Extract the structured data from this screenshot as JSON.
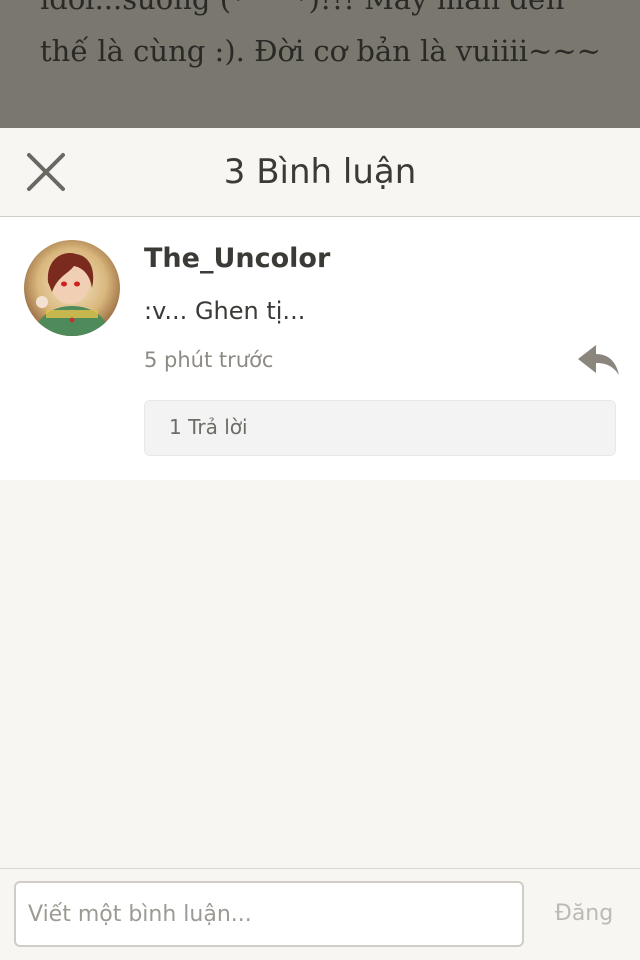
{
  "backdrop": {
    "line1": "idol...sướng (*^^*)!!! May mắn đến",
    "line2": "thế là cùng :). Đời cơ bản là vuiiii~~~"
  },
  "header": {
    "title": "3 Bình luận",
    "close_icon": "close-icon"
  },
  "comments": [
    {
      "avatar": "user-avatar",
      "username": "The_Uncolor",
      "text": ":v... Ghen tị...",
      "time": "5 phút trước",
      "reply_icon": "reply-arrow-icon",
      "replies_label": "1 Trả lời"
    }
  ],
  "compose": {
    "placeholder": "Viết một bình luận...",
    "post_label": "Đăng"
  },
  "colors": {
    "sheet_background": "#f7f6f2",
    "backdrop_overlay": "#7a776e",
    "text_primary": "#3b3a36",
    "text_secondary": "#8e8b84",
    "icon": "#8a867e",
    "post_disabled": "#bdbab3"
  }
}
